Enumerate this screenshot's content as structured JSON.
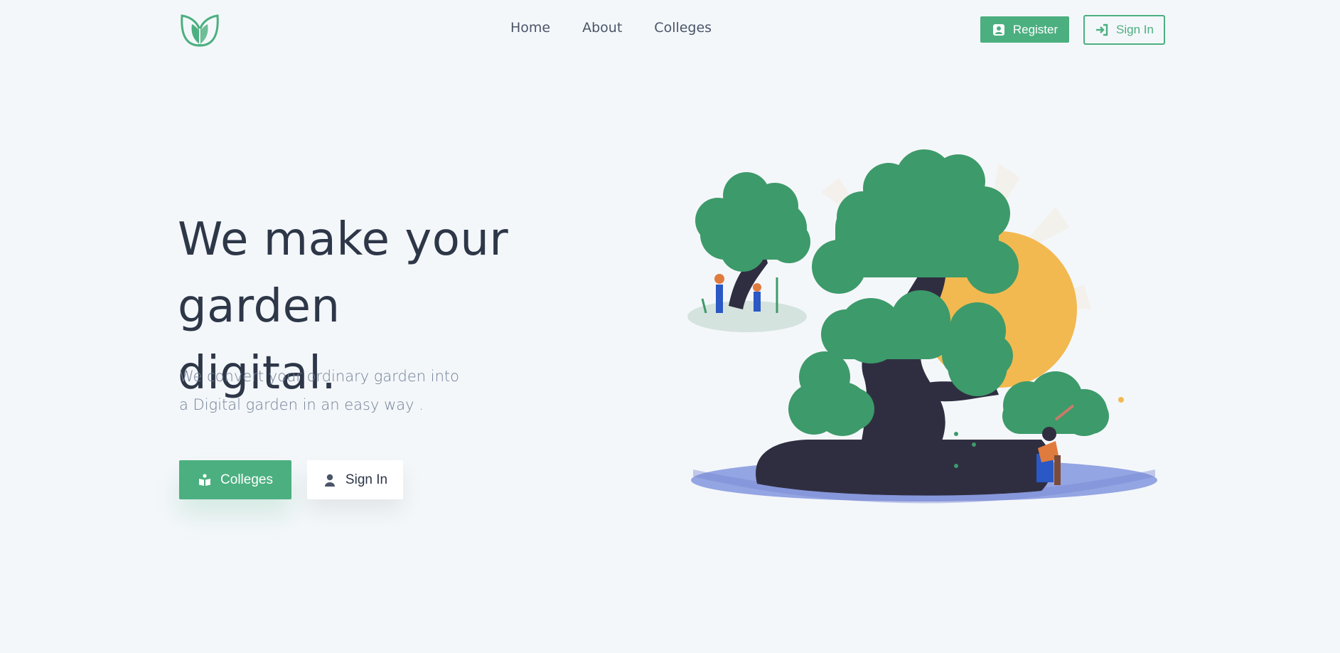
{
  "nav": {
    "links": [
      "Home",
      "About",
      "Colleges"
    ],
    "register_label": "Register",
    "signin_label": "Sign In"
  },
  "hero": {
    "title_line1": "We make your garden",
    "title_line2": "digital.",
    "subtitle_line1": "We convert your ordinary garden into",
    "subtitle_line2": "a Digital garden in an easy way .",
    "colleges_button": "Colleges",
    "signin_button": "Sign In"
  },
  "colors": {
    "brand_green": "#4caf80",
    "tree_green": "#3d9a6a",
    "trunk": "#2f2e41",
    "sun": "#f2b950",
    "water": "#8a9be0"
  },
  "icons": [
    "leaf-logo-icon",
    "user-plus-icon",
    "sign-in-icon",
    "book-icon",
    "user-icon"
  ]
}
